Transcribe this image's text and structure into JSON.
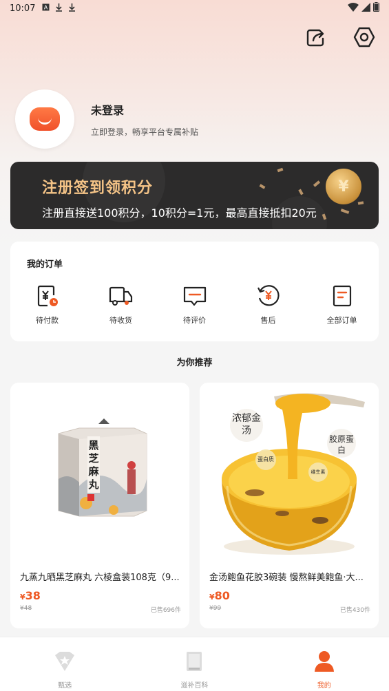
{
  "status_bar": {
    "time": "10:07",
    "icons": [
      "a-box-icon",
      "download-icon",
      "download-icon"
    ]
  },
  "header": {
    "share_icon": "share-icon",
    "settings_icon": "hexagon-settings-icon"
  },
  "profile": {
    "name": "未登录",
    "subtitle": "立即登录，畅享平台专属补贴"
  },
  "banner": {
    "title": "注册签到领积分",
    "subtitle": "注册直接送100积分，10积分=1元，最高直接抵扣20元",
    "coin_symbol": "¥"
  },
  "orders": {
    "title": "我的订单",
    "items": [
      {
        "label": "待付款",
        "icon": "pending-payment-icon"
      },
      {
        "label": "待收货",
        "icon": "delivery-truck-icon"
      },
      {
        "label": "待评价",
        "icon": "review-icon"
      },
      {
        "label": "售后",
        "icon": "refund-icon"
      },
      {
        "label": "全部订单",
        "icon": "all-orders-icon"
      }
    ]
  },
  "recommend": {
    "title": "为你推荐"
  },
  "products": [
    {
      "name": "九蒸九晒黑芝麻丸 六棱盒装108克（9...",
      "price_symbol": "¥",
      "price": "38",
      "original_price": "¥48",
      "sold": "已售696件",
      "image_text": "黑芝麻丸"
    },
    {
      "name": "金汤鲍鱼花胶3碗装 慢熬鲜美鲍鱼·大...",
      "price_symbol": "¥",
      "price": "80",
      "original_price": "¥99",
      "sold": "已售430件",
      "tags": [
        "浓郁金汤",
        "胶原蛋白",
        "蛋白质",
        "维生素"
      ]
    }
  ],
  "tabbar": [
    {
      "label": "甄选",
      "icon": "diamond-star-icon",
      "active": false
    },
    {
      "label": "滋补百科",
      "icon": "book-icon",
      "active": false
    },
    {
      "label": "我的",
      "icon": "user-icon",
      "active": true
    }
  ],
  "colors": {
    "accent": "#ee5a24",
    "banner_bg": "#2c2b2b",
    "banner_title": "#f5c487"
  }
}
